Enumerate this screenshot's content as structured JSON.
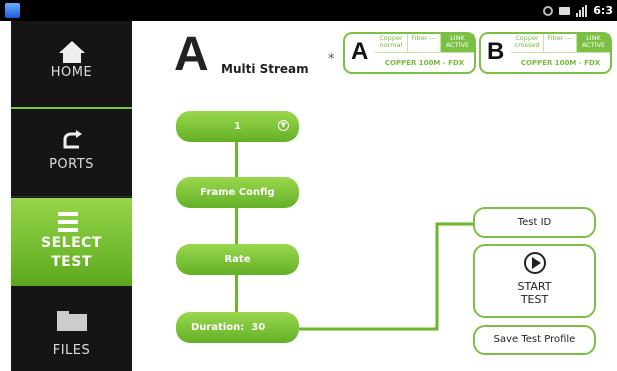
{
  "status_bar": {
    "clock": "6:3",
    "icons": [
      "app-icon",
      "gear-icon",
      "usb-icon",
      "signal-icon"
    ]
  },
  "sidebar": {
    "items": [
      {
        "label": "HOME",
        "icon": "home-icon"
      },
      {
        "label": "PORTS",
        "icon": "ports-icon"
      },
      {
        "label_line1": "SELECT",
        "label_line2": "TEST",
        "icon": "list-check-icon",
        "selected": true
      },
      {
        "label": "FILES",
        "icon": "folder-icon"
      }
    ]
  },
  "header": {
    "letter": "A",
    "title": "Multi Stream",
    "bluetooth_icon": "*"
  },
  "ports": [
    {
      "letter": "A",
      "copper": "Copper normal",
      "fiber": "Fiber ---",
      "link": "LINK ACTIVE",
      "status": "COPPER 100M - FDX"
    },
    {
      "letter": "B",
      "copper": "Copper crossed",
      "fiber": "Fiber ---",
      "link": "LINK ACTIVE",
      "status": "COPPER 100M - FDX"
    }
  ],
  "flow": {
    "stream_count": "1",
    "frame_config": "Frame Config",
    "rate": "Rate",
    "duration": "Duration:  30"
  },
  "actions": {
    "test_id": "Test ID",
    "start_line1": "START",
    "start_line2": "TEST",
    "save_profile": "Save Test Profile"
  },
  "colors": {
    "accent": "#7cc043",
    "sidebar_bg": "#151515",
    "status_bar": "#000000"
  }
}
